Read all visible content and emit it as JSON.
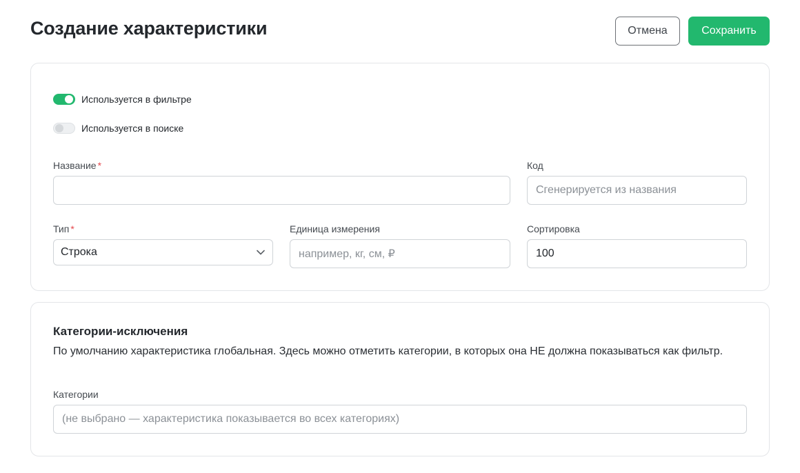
{
  "header": {
    "title": "Создание характеристики",
    "cancel_label": "Отмена",
    "save_label": "Сохранить"
  },
  "toggles": {
    "filter": {
      "label": "Используется в фильтре",
      "checked": true
    },
    "search": {
      "label": "Используется в поиске",
      "checked": false
    }
  },
  "fields": {
    "name": {
      "label": "Название",
      "required_mark": "*",
      "value": ""
    },
    "code": {
      "label": "Код",
      "placeholder": "Сгенерируется из названия"
    },
    "type": {
      "label": "Тип",
      "required_mark": "*",
      "value": "Строка"
    },
    "unit": {
      "label": "Единица измерения",
      "placeholder": "например, кг, см, ₽"
    },
    "sort": {
      "label": "Сортировка",
      "value": "100"
    }
  },
  "exclusions": {
    "title": "Категории-исключения",
    "description": "По умолчанию характеристика глобальная. Здесь можно отметить категории, в которых она НЕ должна показываться как фильтр.",
    "categories_label": "Категории",
    "categories_placeholder": "(не выбрано — характеристика показывается во всех категориях)"
  },
  "colors": {
    "accent": "#22b86e",
    "required": "#e5484d",
    "border": "#cfd3d7"
  },
  "icons": {
    "type_select": "chevron-down-icon"
  }
}
